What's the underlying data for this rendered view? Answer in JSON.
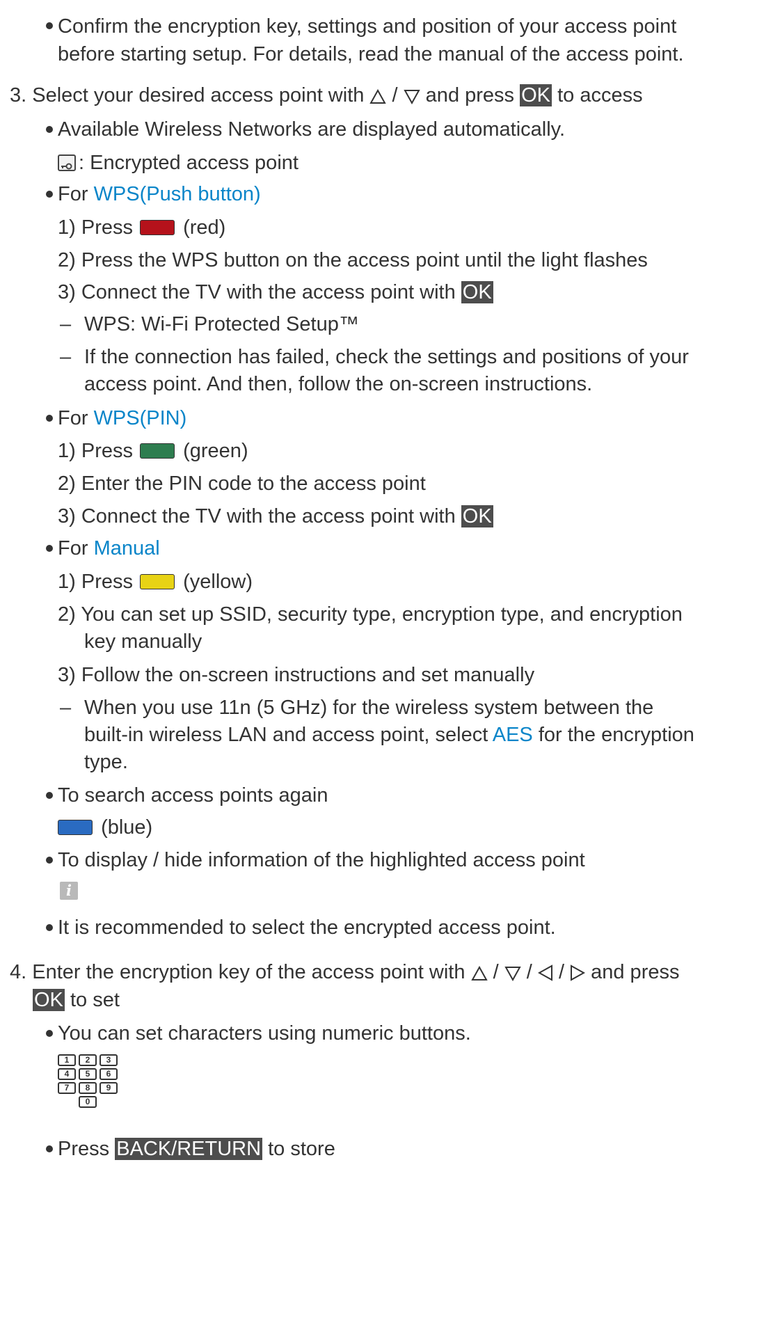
{
  "intro_bullet": {
    "line1": "Confirm the encryption key, settings and position of your access point",
    "line2": "before starting setup. For details, read the manual of the access point."
  },
  "step3": {
    "num": "3.",
    "pre": "Select your desired access point with",
    "sep": " / ",
    "mid": " and press ",
    "ok": "OK",
    "post": " to access",
    "auto_display": "Available Wireless Networks are displayed automatically.",
    "encrypted_label": ": Encrypted access point",
    "wps_push": {
      "for": "For ",
      "link": "WPS(Push button)",
      "step1_num": "1)",
      "step1_pre": "Press ",
      "step1_color": "(red)",
      "step2_num": "2)",
      "step2": "Press the WPS button on the access point until the light flashes",
      "step3_num": "3)",
      "step3_pre": "Connect the TV with the access point with ",
      "step3_ok": "OK",
      "dash": "–",
      "note1": "WPS: Wi-Fi Protected Setup™",
      "note2_line1": "If the connection has failed, check the settings and positions of your",
      "note2_line2": "access point. And then, follow the on-screen instructions."
    },
    "wps_pin": {
      "for": "For ",
      "link": "WPS(PIN)",
      "step1_num": "1)",
      "step1_pre": "Press ",
      "step1_color": "(green)",
      "step2_num": "2)",
      "step2": "Enter the PIN code to the access point",
      "step3_num": "3)",
      "step3_pre": "Connect the TV with the access point with ",
      "step3_ok": "OK"
    },
    "manual": {
      "for": "For ",
      "link": "Manual",
      "step1_num": "1)",
      "step1_pre": "Press ",
      "step1_color": "(yellow)",
      "step2_num": "2)",
      "step2_line1": "You can set up SSID, security type, encryption type, and encryption",
      "step2_line2": "key manually",
      "step3_num": "3)",
      "step3": "Follow the on-screen instructions and set manually",
      "dash": "–",
      "note_line1": "When you use 11n (5 GHz) for the wireless system between the",
      "note_line2_pre": "built-in wireless LAN and access point, select ",
      "note_line2_link": "AES",
      "note_line2_post": " for the encryption",
      "note_line3": "type."
    },
    "search_again": "To search access points again",
    "blue_label": "(blue)",
    "display_info": "To display / hide information of the highlighted access point",
    "recommend": "It is recommended to select the encrypted access point."
  },
  "step4": {
    "num": "4.",
    "pre": "Enter the encryption key of the access point with",
    "sep": " / ",
    "post": " and press",
    "ok": "OK",
    "post2": " to set",
    "numeric": "You can set characters using numeric buttons.",
    "numpad": [
      "1",
      "2",
      "3",
      "4",
      "5",
      "6",
      "7",
      "8",
      "9",
      "0"
    ],
    "store_pre": "Press ",
    "store_key": "BACK/RETURN",
    "store_post": " to store"
  },
  "colors": {
    "link": "#0a85c9",
    "key_bg": "#4d4d4d",
    "red": "#b5121b",
    "green": "#2e7d4f",
    "yellow": "#e8d315",
    "blue": "#2a6bc1"
  }
}
